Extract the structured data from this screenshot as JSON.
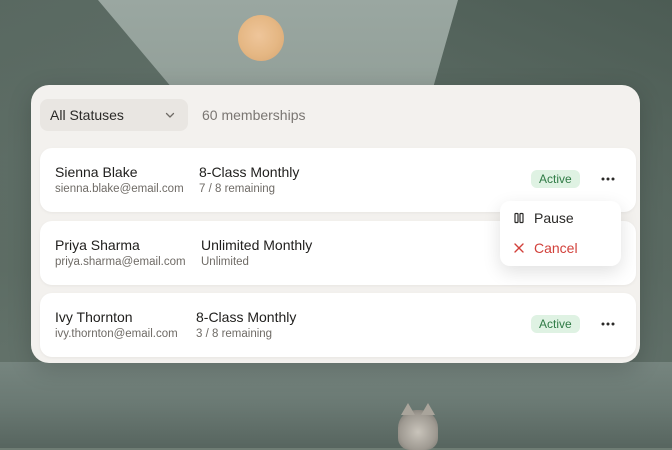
{
  "toolbar": {
    "status_filter": "All Statuses",
    "count_label": "60 memberships"
  },
  "members": [
    {
      "name": "Sienna Blake",
      "email": "sienna.blake@email.com",
      "plan": "8-Class Monthly",
      "detail": "7 / 8 remaining",
      "status": "Active"
    },
    {
      "name": "Priya Sharma",
      "email": "priya.sharma@email.com",
      "plan": "Unlimited Monthly",
      "detail": "Unlimited",
      "status": ""
    },
    {
      "name": "Ivy Thornton",
      "email": "ivy.thornton@email.com",
      "plan": "8-Class Monthly",
      "detail": "3 / 8 remaining",
      "status": "Active"
    }
  ],
  "row_menu": {
    "pause_label": "Pause",
    "cancel_label": "Cancel"
  },
  "colors": {
    "active_badge_bg": "#dff2e3",
    "active_badge_text": "#2f7a45",
    "danger": "#d2413b"
  },
  "icons": {
    "filter": "chevron-down-icon",
    "row_actions": "more-horizontal-icon",
    "pause": "pause-icon",
    "cancel": "close-icon"
  }
}
